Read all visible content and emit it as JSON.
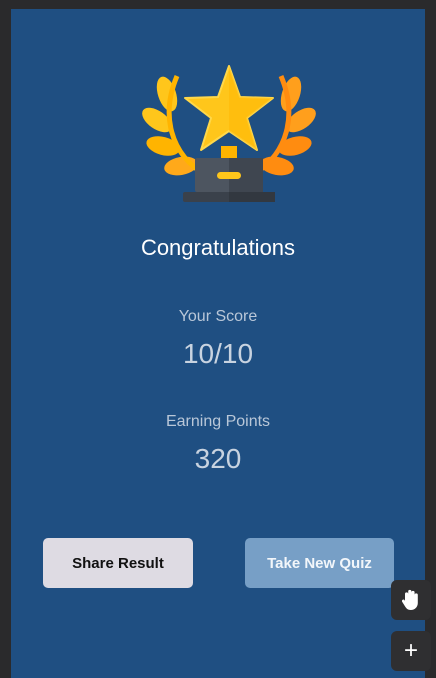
{
  "title": "Congratulations",
  "score": {
    "label": "Your Score",
    "value": "10/10"
  },
  "points": {
    "label": "Earning Points",
    "value": "320"
  },
  "buttons": {
    "share_label": "Share Result",
    "new_quiz_label": "Take New Quiz"
  },
  "tools": {
    "hand": "hand-icon",
    "add": "+"
  },
  "colors": {
    "background": "#1f4f82",
    "share_button": "#dedbe3",
    "new_quiz_button": "#779fc6",
    "trophy_gold": "#ffc61b",
    "trophy_orange": "#ff9f1c",
    "trophy_base": "#4d5560"
  }
}
